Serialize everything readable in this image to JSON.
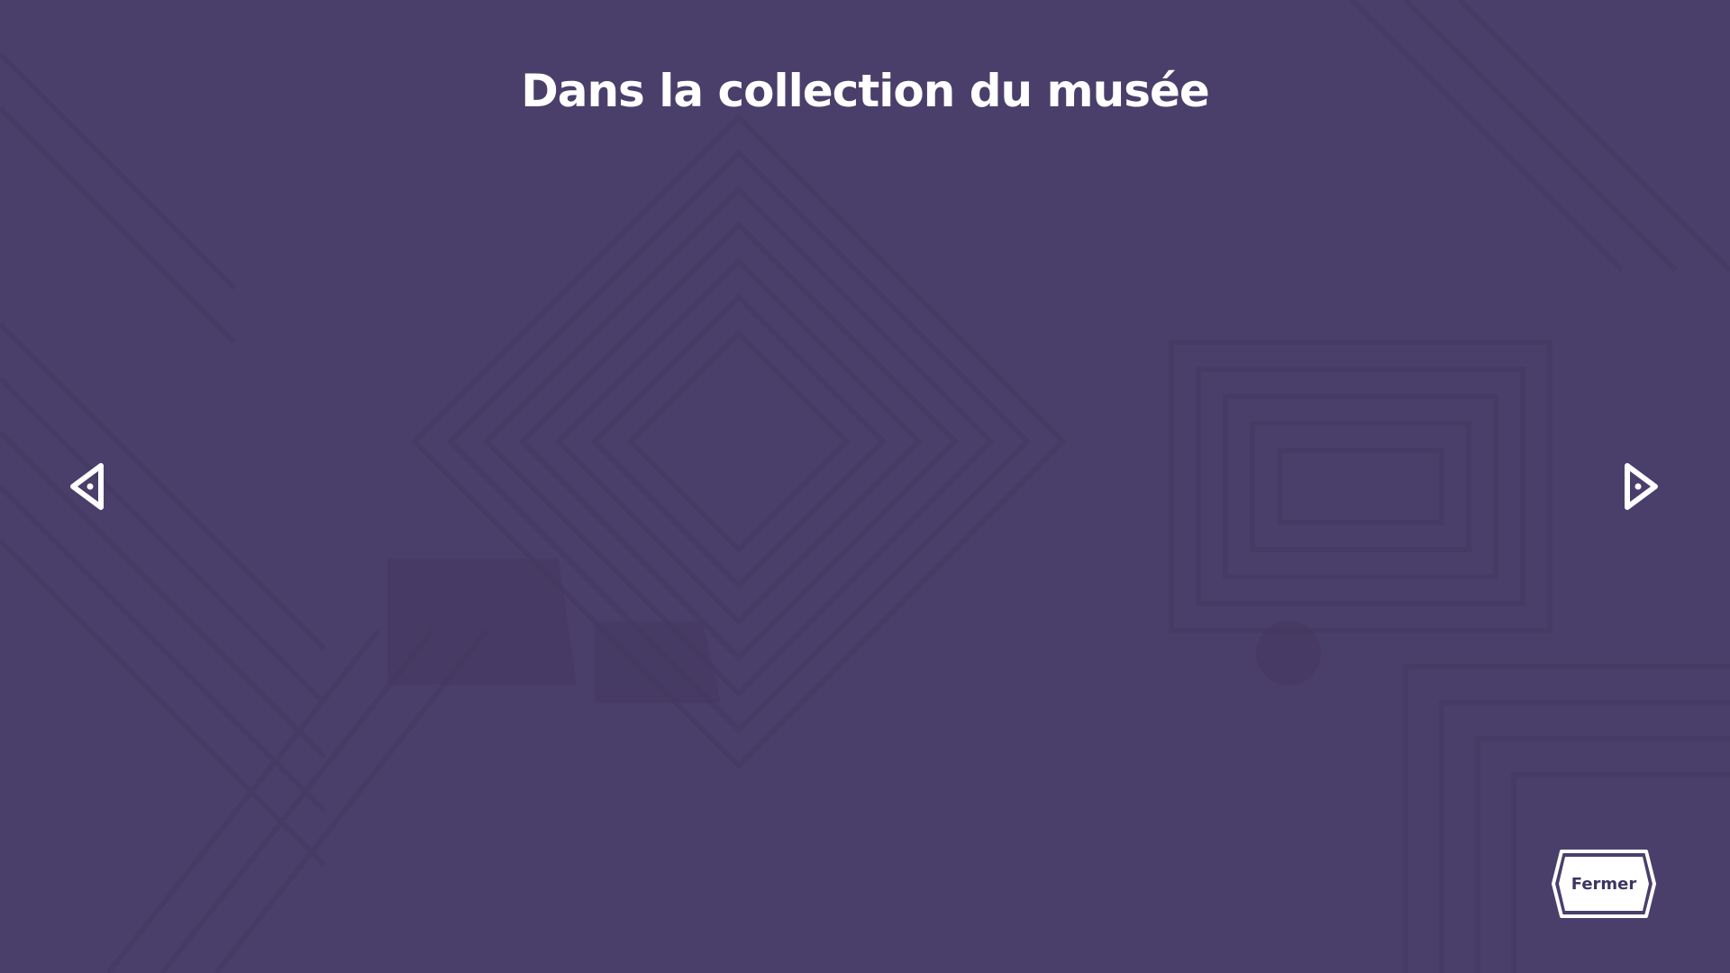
{
  "page": {
    "title": "Dans la collection du musée",
    "background_color": "#4a3f6b",
    "pattern_color": "#43385f"
  },
  "navigation": {
    "previous_icon": "triangle-left-icon",
    "next_icon": "triangle-right-icon"
  },
  "close_button": {
    "label": "Fermer",
    "text_color": "#3f3562",
    "fill_color": "#ffffff"
  }
}
